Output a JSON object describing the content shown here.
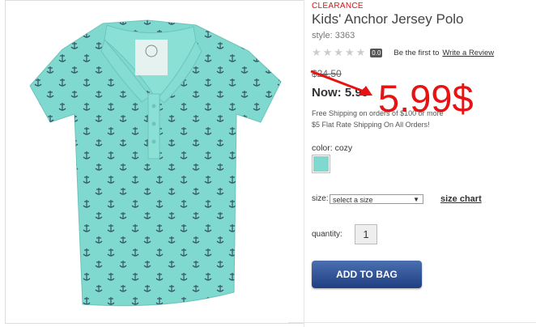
{
  "product": {
    "badge": "CLEARANCE",
    "title": "Kids' Anchor Jersey Polo",
    "style": "style: 3363",
    "image_icon": "shirt-image",
    "rating": {
      "stars": "★★★★★",
      "score": "0.0",
      "first_text": "Be the first to",
      "write_link": "Write a Review"
    },
    "price": {
      "was": "$24.50",
      "now_label": "Now:",
      "now_value": "5.99",
      "shipping_line1": "Free Shipping on orders of $100 or more",
      "shipping_line2": "$5 Flat Rate Shipping On All Orders!"
    },
    "annotation": "5.99$",
    "color_label": "color: cozy",
    "swatch_color": "#7fd9cf",
    "size_label": "size:",
    "size_select": "select a size",
    "size_chart": "size chart",
    "quantity_label": "quantity:",
    "quantity_value": "1",
    "add_to_bag": "ADD TO BAG"
  },
  "colors": {
    "accent_red": "#e81212",
    "button_blue": "#203f82",
    "shirt": "#7fd9cf"
  }
}
